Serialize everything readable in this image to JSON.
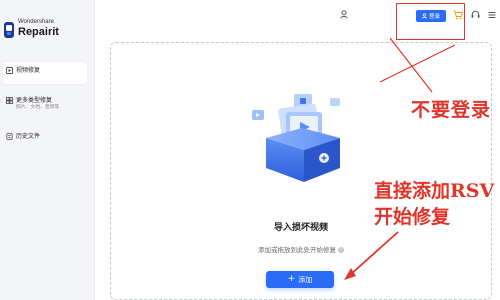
{
  "app": {
    "brand_small": "Wondershare",
    "brand_name": "Repairit"
  },
  "sidebar": {
    "items": [
      {
        "label": "视频修复",
        "sub": "",
        "active": true,
        "icon": "play-icon"
      },
      {
        "label": "更多类型修复",
        "sub": "照片、文档、音频等",
        "active": false,
        "icon": "grid-icon"
      },
      {
        "label": "历史文件",
        "sub": "",
        "active": false,
        "icon": "history-icon"
      }
    ]
  },
  "topbar": {
    "login_label": "登录",
    "icons": [
      "user-icon",
      "cart-icon",
      "support-icon",
      "menu-icon"
    ]
  },
  "dropzone": {
    "title": "导入损坏视频",
    "hint": "添加或拖放到此处开始修复",
    "add_label": "添加",
    "icon": "video-folder-illustration"
  },
  "annotations": {
    "no_login": "不要登录",
    "add_direct_line1": "直接添加RSV",
    "add_direct_line2": "开始修复",
    "color": "#e0352b"
  },
  "colors": {
    "accent": "#2b6cf6",
    "sidebar_bg": "#f4f5f8",
    "annotation": "#e0352b"
  }
}
